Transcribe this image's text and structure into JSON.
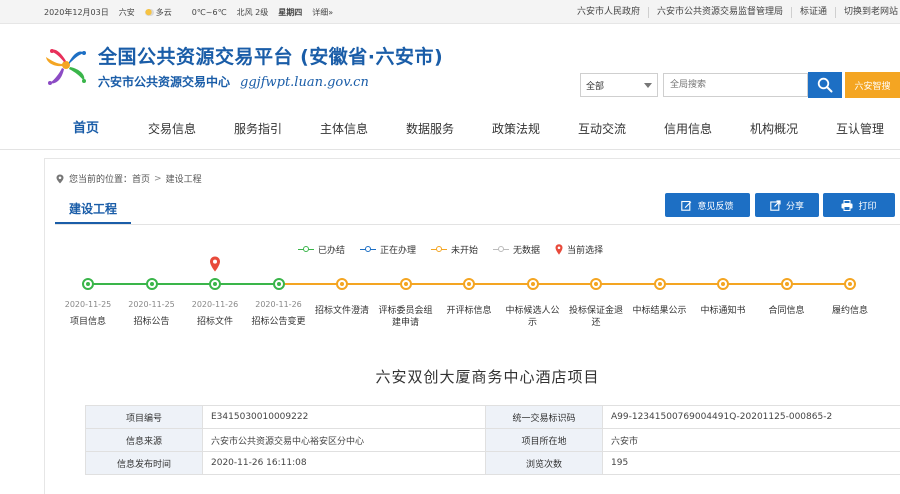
{
  "topbar": {
    "date": "2020年12月03日",
    "city": "六安",
    "weather": "多云",
    "temp": "0℃~6℃",
    "wind": "北风 2级",
    "weekday": "星期四",
    "detail": "详细»",
    "links": [
      "六安市人民政府",
      "六安市公共资源交易监督管理局",
      "标证通",
      "切换到老网站"
    ]
  },
  "header": {
    "title": "全国公共资源交易平台 (安徽省·六安市)",
    "subtitle": "六安市公共资源交易中心",
    "url": "ggjfwpt.luan.gov.cn"
  },
  "search": {
    "scope": "全部",
    "placeholder": "全局搜索",
    "smart_label": "六安智搜"
  },
  "nav": [
    "首页",
    "交易信息",
    "服务指引",
    "主体信息",
    "数据服务",
    "政策法规",
    "互动交流",
    "信用信息",
    "机构概况",
    "互认管理"
  ],
  "breadcrumb": {
    "prefix": "您当前的位置：",
    "home": "首页",
    "sep": ">",
    "current": "建设工程"
  },
  "section_tab": "建设工程",
  "actions": {
    "feedback": "意见反馈",
    "share": "分享",
    "print": "打印"
  },
  "legend": {
    "done": "已办结",
    "doing": "正在办理",
    "todo": "未开始",
    "nodata": "无数据",
    "current": "当前选择"
  },
  "colors": {
    "done": "#3ab54a",
    "todo": "#f4a522",
    "doing": "#1d6fc4",
    "nodata": "#bbbbbb",
    "current": "#e84a3b"
  },
  "timeline": [
    {
      "date": "2020-11-25",
      "label": "项目信息",
      "status": "done"
    },
    {
      "date": "2020-11-25",
      "label": "招标公告",
      "status": "done"
    },
    {
      "date": "2020-11-26",
      "label": "招标文件",
      "status": "done",
      "current": true
    },
    {
      "date": "2020-11-26",
      "label": "招标公告变更",
      "status": "done"
    },
    {
      "date": "",
      "label": "招标文件澄清",
      "status": "todo"
    },
    {
      "date": "",
      "label": "评标委员会组建申请",
      "status": "todo"
    },
    {
      "date": "",
      "label": "开评标信息",
      "status": "todo"
    },
    {
      "date": "",
      "label": "中标候选人公示",
      "status": "todo"
    },
    {
      "date": "",
      "label": "投标保证金退还",
      "status": "todo"
    },
    {
      "date": "",
      "label": "中标结果公示",
      "status": "todo"
    },
    {
      "date": "",
      "label": "中标通知书",
      "status": "todo"
    },
    {
      "date": "",
      "label": "合同信息",
      "status": "todo"
    },
    {
      "date": "",
      "label": "履约信息",
      "status": "todo"
    }
  ],
  "project": {
    "title": "六安双创大厦商务中心酒店项目",
    "rows": [
      {
        "k1": "项目编号",
        "v1": "E3415030010009222",
        "k2": "统一交易标识码",
        "v2": "A99-12341500769004491Q-20201125-000865-2"
      },
      {
        "k1": "信息来源",
        "v1": "六安市公共资源交易中心裕安区分中心",
        "k2": "项目所在地",
        "v2": "六安市"
      },
      {
        "k1": "信息发布时间",
        "v1": "2020-11-26 16:11:08",
        "k2": "浏览次数",
        "v2": "195"
      }
    ]
  }
}
